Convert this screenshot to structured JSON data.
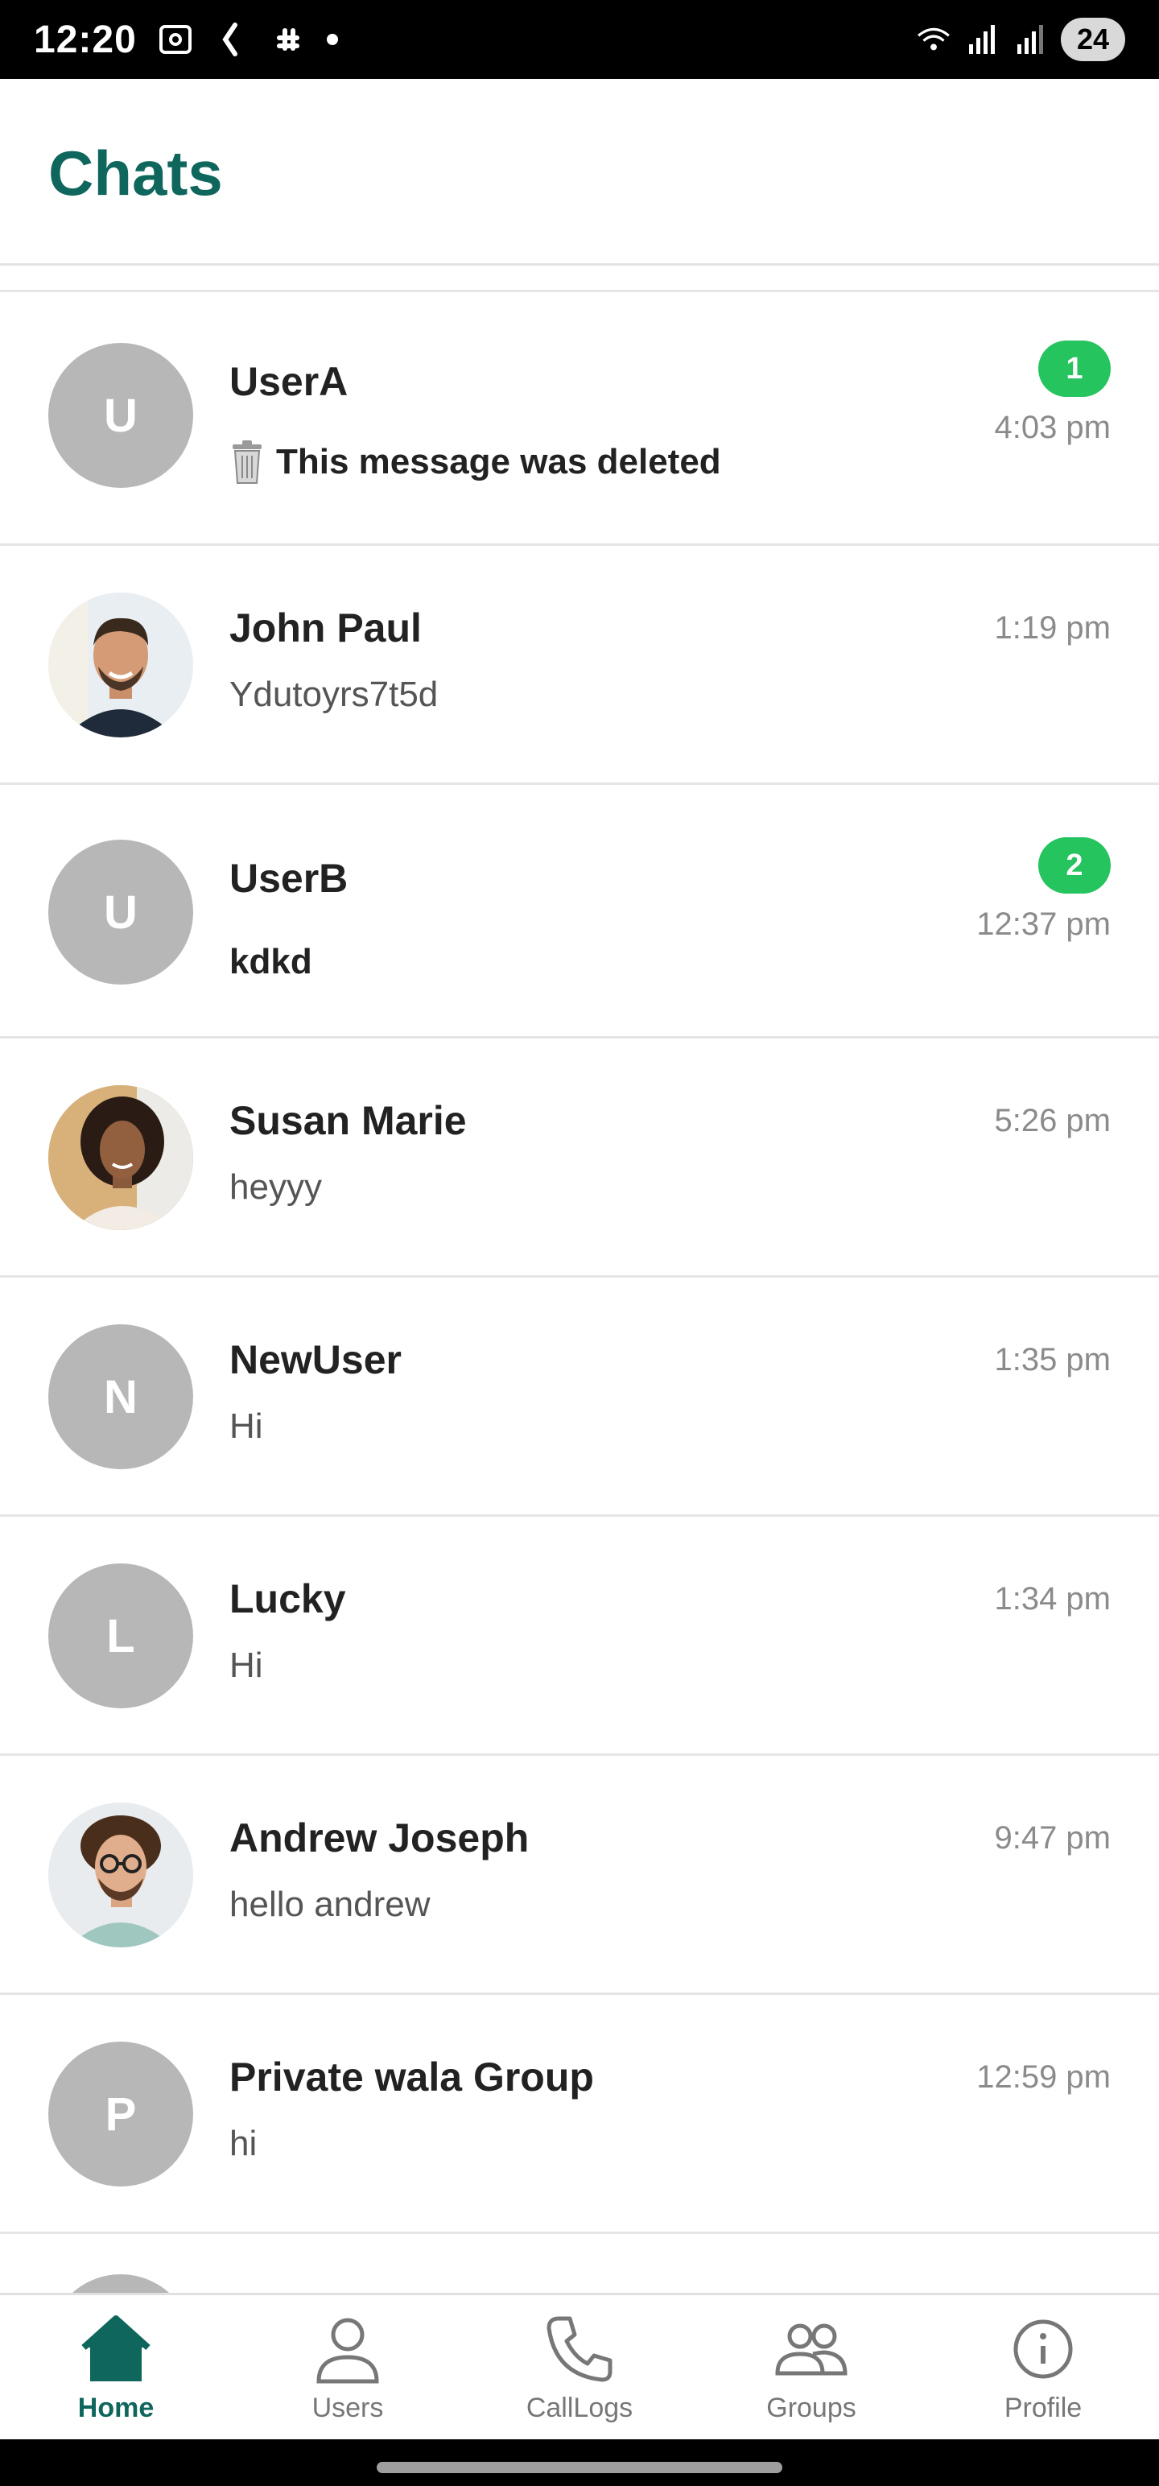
{
  "status_bar": {
    "time": "12:20",
    "battery": "24"
  },
  "header": {
    "title": "Chats"
  },
  "chats": [
    {
      "avatar_letter": "U",
      "name": "UserA",
      "preview": "This message was deleted",
      "time": "4:03 pm",
      "unread": "1",
      "deleted": true
    },
    {
      "avatar_letter": "",
      "name": "John Paul",
      "preview": "Ydutoyrs7t5d",
      "time": "1:19 pm",
      "unread": ""
    },
    {
      "avatar_letter": "U",
      "name": "UserB",
      "preview": "kdkd",
      "time": "12:37 pm",
      "unread": "2"
    },
    {
      "avatar_letter": "",
      "name": "Susan Marie",
      "preview": "heyyy",
      "time": "5:26 pm",
      "unread": ""
    },
    {
      "avatar_letter": "N",
      "name": "NewUser",
      "preview": "Hi",
      "time": "1:35 pm",
      "unread": ""
    },
    {
      "avatar_letter": "L",
      "name": "Lucky",
      "preview": "Hi",
      "time": "1:34 pm",
      "unread": ""
    },
    {
      "avatar_letter": "",
      "name": "Andrew Joseph",
      "preview": "hello andrew",
      "time": "9:47 pm",
      "unread": ""
    },
    {
      "avatar_letter": "P",
      "name": "Private wala Group",
      "preview": "hi",
      "time": "12:59 pm",
      "unread": ""
    }
  ],
  "bottom_nav": {
    "items": [
      {
        "label": "Home",
        "icon": "home-icon",
        "active": true
      },
      {
        "label": "Users",
        "icon": "user-icon",
        "active": false
      },
      {
        "label": "CallLogs",
        "icon": "phone-icon",
        "active": false
      },
      {
        "label": "Groups",
        "icon": "groups-icon",
        "active": false
      },
      {
        "label": "Profile",
        "icon": "info-icon",
        "active": false
      }
    ]
  },
  "colors": {
    "brand": "#0f665c",
    "badge": "#25c45f",
    "avatar_placeholder": "#b7b7b7"
  }
}
